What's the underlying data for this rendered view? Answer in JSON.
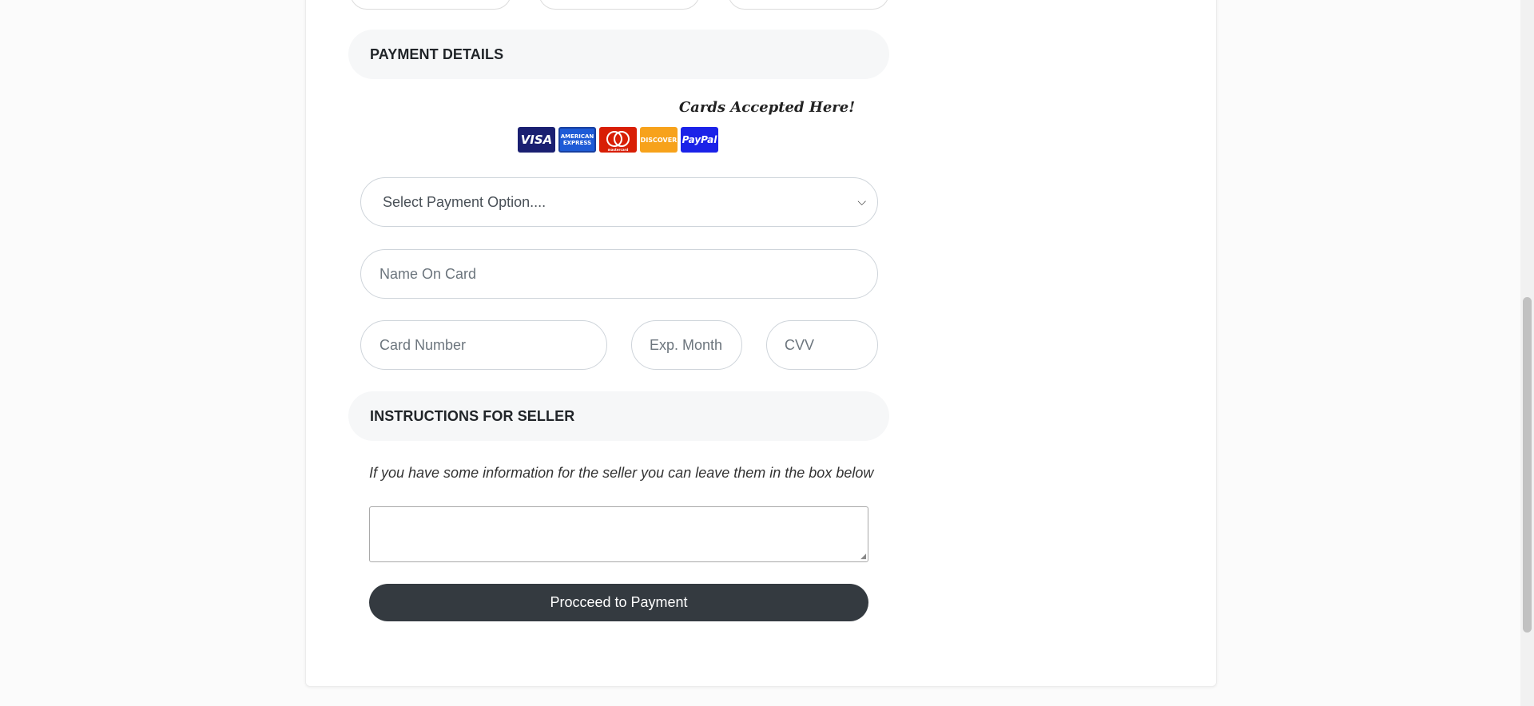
{
  "payment_section": {
    "heading": "PAYMENT DETAILS"
  },
  "cards_accepted": {
    "title": "Cards Accepted Here!",
    "logos": [
      {
        "name": "visa-logo",
        "text": "VISA"
      },
      {
        "name": "amex-logo",
        "text": "AMERICAN EXPRESS"
      },
      {
        "name": "mastercard-logo",
        "text": "mastercard"
      },
      {
        "name": "discover-logo",
        "text": "DISCOVER"
      },
      {
        "name": "paypal-logo",
        "text": "PayPal"
      }
    ]
  },
  "form": {
    "payment_option": {
      "selected": "Select Payment Option...."
    },
    "name_on_card": {
      "placeholder": "Name On Card"
    },
    "card_number": {
      "placeholder": "Card Number"
    },
    "exp_month": {
      "placeholder": "Exp. Month"
    },
    "cvv": {
      "placeholder": "CVV"
    }
  },
  "instructions_section": {
    "heading": "INSTRUCTIONS FOR SELLER",
    "info_text": "If you have some information for the seller you can leave them in the box below",
    "textarea_value": ""
  },
  "submit": {
    "label": "Procceed to Payment"
  },
  "colors": {
    "button_bg": "#343a40",
    "section_bg": "#f6f7f8",
    "page_bg": "#fbfbfb"
  }
}
